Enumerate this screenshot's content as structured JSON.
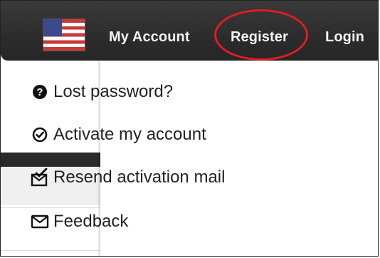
{
  "nav": {
    "flag_icon": "us-flag-icon",
    "my_account": "My Account",
    "register": "Register",
    "login": "Login"
  },
  "dropdown": {
    "items": [
      {
        "label": "Lost password?",
        "icon": "question-circle-icon"
      },
      {
        "label": "Activate my account",
        "icon": "check-circle-icon"
      },
      {
        "label": "Resend activation mail",
        "icon": "envelope-check-icon"
      },
      {
        "label": "Feedback",
        "icon": "envelope-icon"
      }
    ]
  },
  "colors": {
    "nav_bg": "#2c2c2c",
    "highlight": "#e01c24"
  }
}
